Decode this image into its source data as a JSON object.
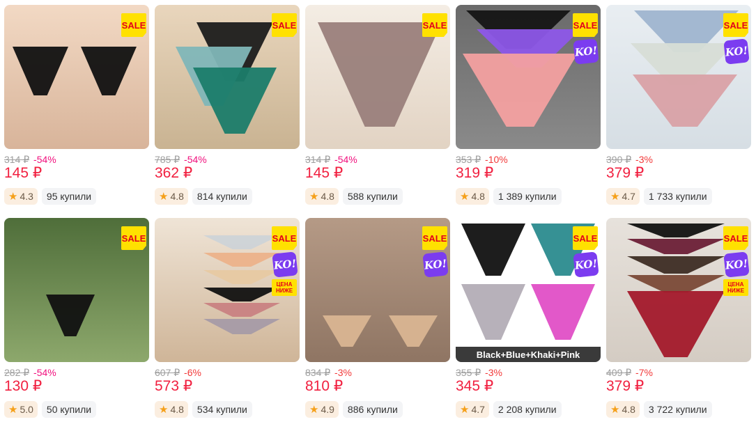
{
  "products": [
    {
      "old_price": "314 ₽",
      "discount": "-54%",
      "price": "145 ₽",
      "rating": "4.3",
      "bought": "95 купили",
      "sale": "SALE",
      "ko": "",
      "price_lower": "",
      "caption": ""
    },
    {
      "old_price": "785 ₽",
      "discount": "-54%",
      "price": "362 ₽",
      "rating": "4.8",
      "bought": "814 купили",
      "sale": "SALE",
      "ko": "",
      "price_lower": "",
      "caption": ""
    },
    {
      "old_price": "314 ₽",
      "discount": "-54%",
      "price": "145 ₽",
      "rating": "4.8",
      "bought": "588 купили",
      "sale": "SALE",
      "ko": "",
      "price_lower": "",
      "caption": ""
    },
    {
      "old_price": "353 ₽",
      "discount": "-10%",
      "price": "319 ₽",
      "rating": "4.8",
      "bought": "1 389 купили",
      "sale": "SALE",
      "ko": "KO!",
      "price_lower": "",
      "caption": ""
    },
    {
      "old_price": "390 ₽",
      "discount": "-3%",
      "price": "379 ₽",
      "rating": "4.7",
      "bought": "1 733 купили",
      "sale": "SALE",
      "ko": "KO!",
      "price_lower": "",
      "caption": ""
    },
    {
      "old_price": "282 ₽",
      "discount": "-54%",
      "price": "130 ₽",
      "rating": "5.0",
      "bought": "50 купили",
      "sale": "SALE",
      "ko": "",
      "price_lower": "",
      "caption": ""
    },
    {
      "old_price": "607 ₽",
      "discount": "-6%",
      "price": "573 ₽",
      "rating": "4.8",
      "bought": "534 купили",
      "sale": "SALE",
      "ko": "KO!",
      "price_lower": "ЦЕНА НИЖЕ",
      "caption": ""
    },
    {
      "old_price": "834 ₽",
      "discount": "-3%",
      "price": "810 ₽",
      "rating": "4.9",
      "bought": "886 купили",
      "sale": "SALE",
      "ko": "KO!",
      "price_lower": "",
      "caption": ""
    },
    {
      "old_price": "355 ₽",
      "discount": "-3%",
      "price": "345 ₽",
      "rating": "4.7",
      "bought": "2 208 купили",
      "sale": "SALE",
      "ko": "KO!",
      "price_lower": "",
      "caption": "Black+Blue+Khaki+Pink"
    },
    {
      "old_price": "409 ₽",
      "discount": "-7%",
      "price": "379 ₽",
      "rating": "4.8",
      "bought": "3 722 купили",
      "sale": "SALE",
      "ko": "KO!",
      "price_lower": "ЦЕНА НИЖЕ",
      "caption": ""
    }
  ],
  "icons": {
    "rating": "star-icon"
  },
  "colors": {
    "price": "#f11f3f",
    "discount": "#f1117e",
    "sale_badge": "#ffe100",
    "ko_badge": "#7b3cf0",
    "rating_bg": "#fbeee0",
    "star": "#f5a01a"
  }
}
